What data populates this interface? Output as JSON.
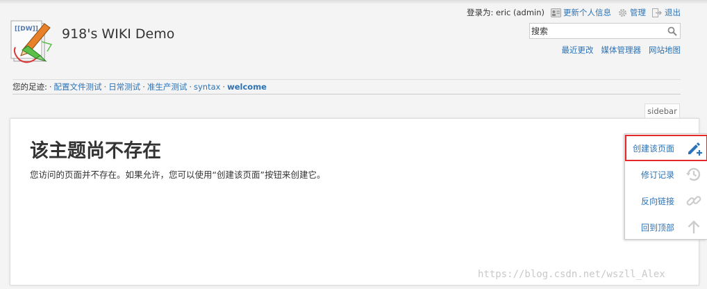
{
  "header": {
    "site_title": "918's WIKI Demo",
    "logo_text": "[[DW]]"
  },
  "user_tools": {
    "login_label": "登录为: eric (admin)",
    "profile_label": "更新个人信息",
    "admin_label": "管理",
    "logout_label": "退出"
  },
  "search": {
    "value": "搜索"
  },
  "site_tools": {
    "recent_changes": "最近更改",
    "media_manager": "媒体管理器",
    "sitemap": "网站地图"
  },
  "breadcrumbs": {
    "label": "您的足迹:",
    "items": [
      "配置文件测试",
      "日常测试",
      "准生产测试",
      "syntax",
      "welcome"
    ]
  },
  "sidebar_tab": {
    "label": "sidebar"
  },
  "page": {
    "heading": "该主题尚不存在",
    "text": "您访问的页面并不存在。如果允许，您可以使用“创建该页面”按钮来创建它。"
  },
  "page_tools": {
    "items": [
      {
        "label": "创建该页面",
        "icon": "pencil-plus-icon"
      },
      {
        "label": "修订记录",
        "icon": "history-icon"
      },
      {
        "label": "反向链接",
        "icon": "link-icon"
      },
      {
        "label": "回到顶部",
        "icon": "arrow-up-icon"
      }
    ]
  },
  "watermark": "https://blog.csdn.net/wszll_Alex",
  "colors": {
    "link": "#2b73b7",
    "highlight_border": "#e5292a",
    "icon_active": "#2b73b7",
    "icon_inactive": "#cccccc"
  }
}
